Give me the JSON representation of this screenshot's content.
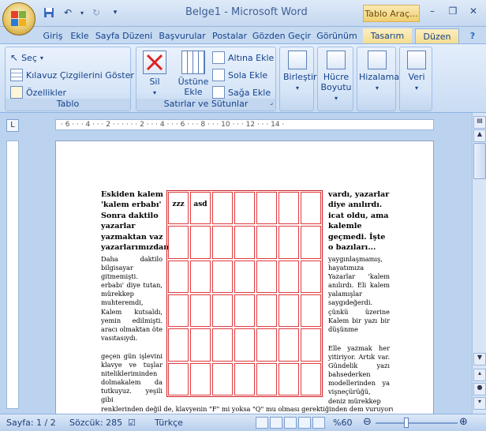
{
  "window": {
    "title": "Belge1 - Microsoft Word",
    "context_tab_title": "Tablo Araç..."
  },
  "quick_access": [
    "save-icon",
    "undo-icon",
    "redo-icon",
    "customize-icon"
  ],
  "tabs": [
    {
      "label": "Giriş"
    },
    {
      "label": "Ekle"
    },
    {
      "label": "Sayfa Düzeni"
    },
    {
      "label": "Başvurular"
    },
    {
      "label": "Postalar"
    },
    {
      "label": "Gözden Geçir"
    },
    {
      "label": "Görünüm"
    },
    {
      "label": "Tasarım"
    },
    {
      "label": "Düzen"
    }
  ],
  "ribbon": {
    "tablo": {
      "label": "Tablo",
      "sec": "Seç",
      "kilavuz": "Kılavuz Çizgilerini Göster",
      "ozellikler": "Özellikler"
    },
    "satirlar": {
      "label": "Satırlar ve Sütunlar",
      "sil": "Sil",
      "ustune_ekle": "Üstüne Ekle",
      "altina_ekle": "Altına Ekle",
      "sola_ekle": "Sola Ekle",
      "saga_ekle": "Sağa Ekle"
    },
    "birlestir": "Birleştir",
    "hucre_boyutu": "Hücre Boyutu",
    "hizalama": "Hizalama",
    "veri": "Veri"
  },
  "ruler": {
    "marks": "· 6 · · · 4 · · · 2 · · ·  · · · 2 · · · 4 · · · 6 · · · 8 · · · 10 · · · 12 · · · 14 ·"
  },
  "document": {
    "left_bold": "Eskiden kalem 'kalem erbabı' Sonra daktilo yazarlar yazmaktan vaz yazarlarımızdan",
    "left_body_1": "Daha daktilo bilgisayar gitmemişti. erbabı' diye tutan, mürekkep muhteremdi, Kalem kutsaldı, yemin edilmişti. aracı olmaktan öte vasıtasıydı.",
    "left_body_2": "geçen gün işlevini klavye ve tuşlar nitelikleriminden dolmakalem da tutkuyuz. yeşili gibi",
    "right_bold": "vardı, yazarlar diye anılırdı. icat oldu, ama kalemle geçmedi. İşte o bazıları...",
    "right_body_1": "yaygınlaşmamış, hayatımıza Yazarlar 'kalem anılırdı. Eli kalem yalamışlar saygıdeğerdi. çünkü üzerine Kalem bir yazı bir düşünme",
    "right_body_2": "Elle yazmak her yitiriyor. Artık var. Gündelik yazı bahsederken modellerinden ya vişneçürüğü, deniz mürekkep",
    "bottom_line": "renklerinden değil de, klavyenin \"F\" mi yoksa \"Q\" mu olması gerektiğinden dem vuruyoruz.",
    "table_cells": [
      "zzz",
      "asd"
    ]
  },
  "status": {
    "sayfa": "Sayfa: 1 / 2",
    "sozcuk": "Sözcük: 285",
    "dil": "Türkçe",
    "zoom": "%60"
  }
}
